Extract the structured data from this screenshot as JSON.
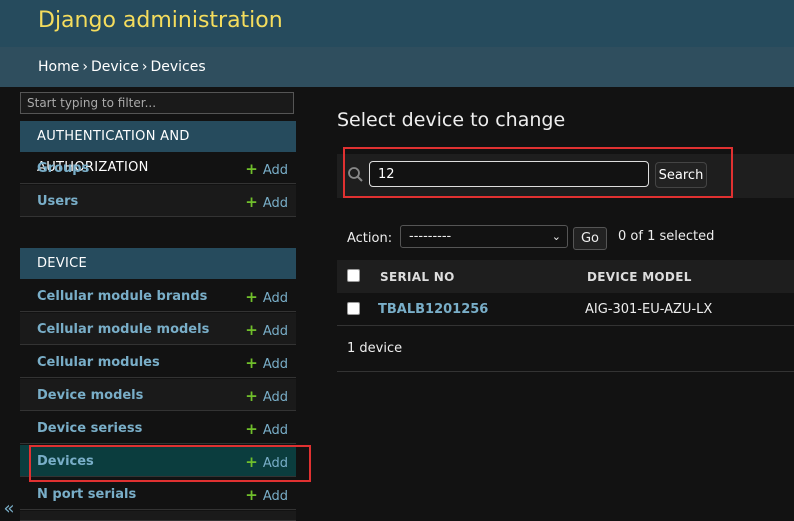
{
  "header": {
    "title": "Django administration"
  },
  "breadcrumbs": [
    "Home",
    "Device",
    "Devices"
  ],
  "sidebar": {
    "filter_placeholder": "Start typing to filter...",
    "modules": [
      {
        "caption": "AUTHENTICATION AND AUTHORIZATION",
        "items": [
          {
            "label": "Groups",
            "add": "Add"
          },
          {
            "label": "Users",
            "add": "Add"
          }
        ]
      },
      {
        "caption": "DEVICE",
        "items": [
          {
            "label": "Cellular module brands",
            "add": "Add"
          },
          {
            "label": "Cellular module models",
            "add": "Add"
          },
          {
            "label": "Cellular modules",
            "add": "Add"
          },
          {
            "label": "Device models",
            "add": "Add"
          },
          {
            "label": "Device seriess",
            "add": "Add"
          },
          {
            "label": "Devices",
            "add": "Add"
          },
          {
            "label": "N port serials",
            "add": "Add"
          }
        ]
      }
    ],
    "collapse": "«"
  },
  "main": {
    "title": "Select device to change",
    "search": {
      "value": "12",
      "button": "Search"
    },
    "actions": {
      "label": "Action:",
      "selected": "---------",
      "go": "Go",
      "count": "0 of 1 selected"
    },
    "table": {
      "headers": [
        "SERIAL NO",
        "DEVICE MODEL"
      ],
      "rows": [
        {
          "serial": "TBALB1201256",
          "model": "AIG-301-EU-AZU-LX"
        }
      ]
    },
    "paginator": "1 device"
  },
  "colors": {
    "header_bg": "#264b5d",
    "branding": "#f5dd5d",
    "link": "#79aec8",
    "add_plus": "#70bf2b",
    "highlight": "#e03131"
  }
}
